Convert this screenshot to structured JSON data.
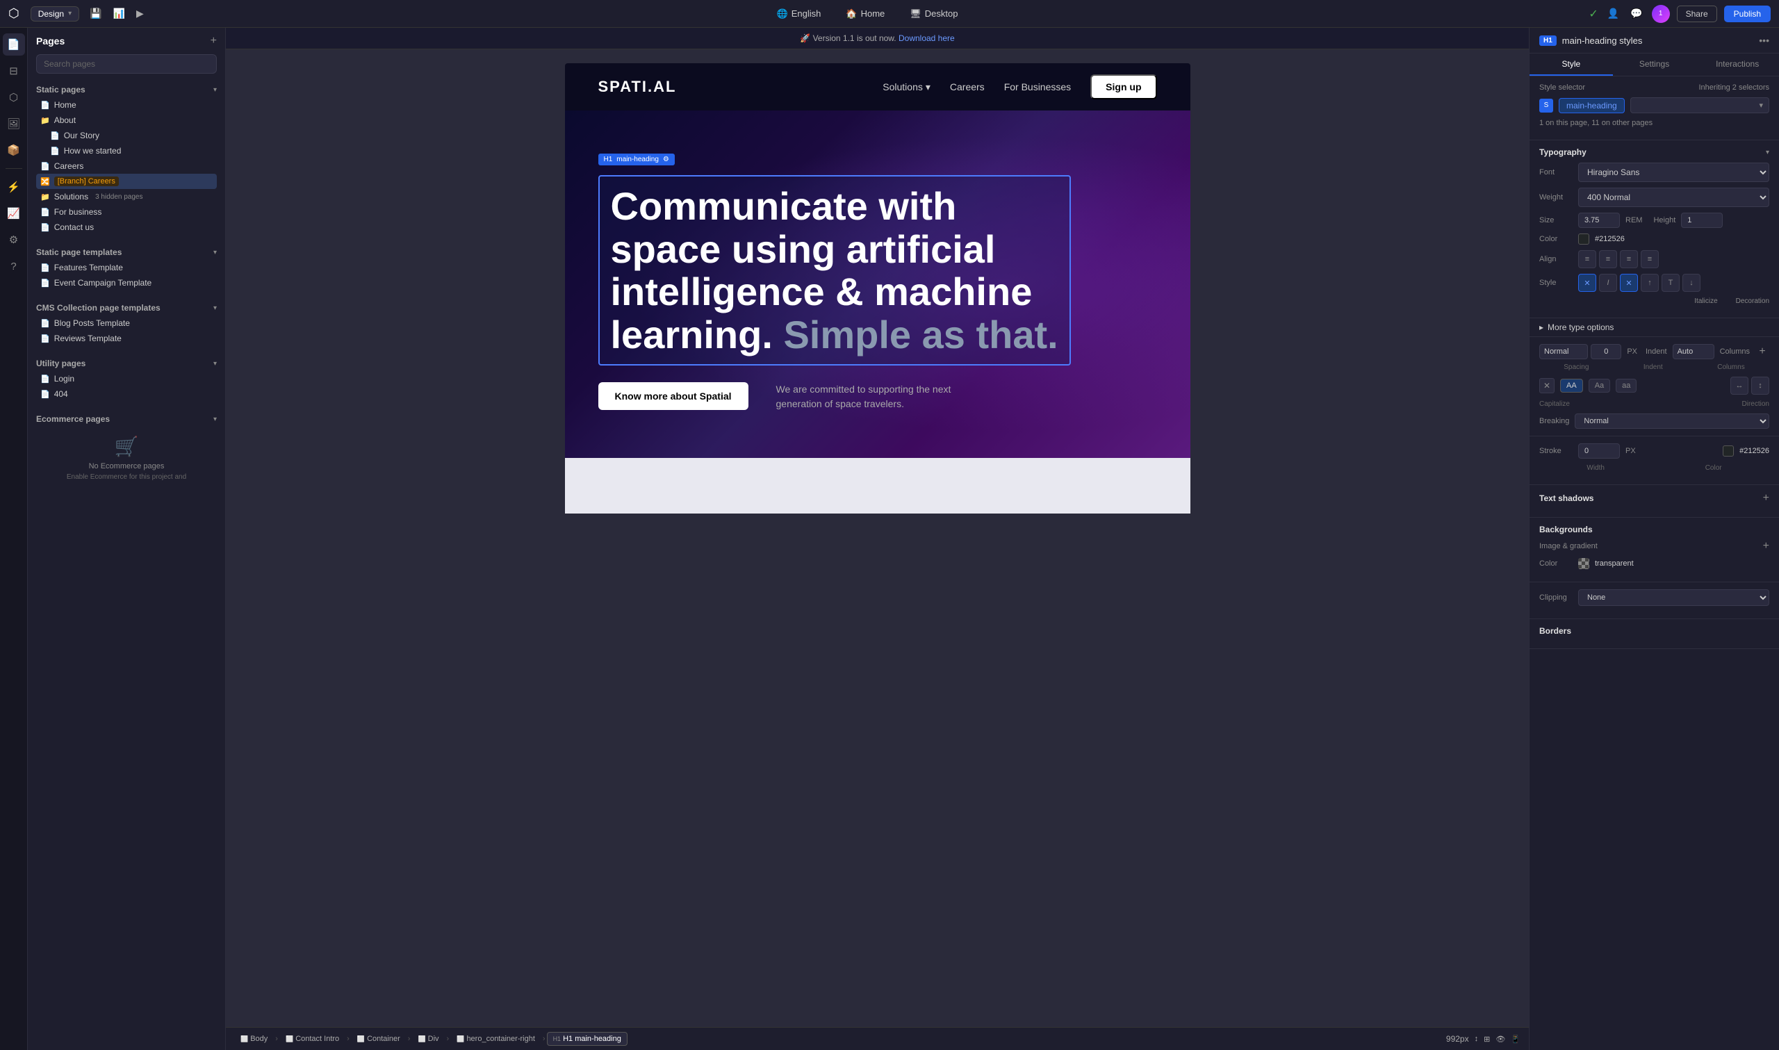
{
  "app": {
    "mode": "Design",
    "publish_label": "Publish",
    "share_label": "Share"
  },
  "topbar": {
    "mode": "Design",
    "icons": [
      "save-icon",
      "analytics-icon",
      "play-icon"
    ],
    "center_items": [
      {
        "label": "English",
        "icon": "globe-icon"
      },
      {
        "label": "Home",
        "icon": "home-icon"
      },
      {
        "label": "Desktop",
        "icon": "desktop-icon"
      }
    ],
    "version_banner": "Version 1.1 is out now.",
    "version_link": "Download here"
  },
  "sidebar": {
    "title": "Pages",
    "search_placeholder": "Search pages",
    "sections": [
      {
        "title": "Static pages",
        "pages": [
          {
            "label": "Home",
            "type": "page",
            "indent": 0
          },
          {
            "label": "About",
            "type": "folder",
            "indent": 0
          },
          {
            "label": "Our Story",
            "type": "page",
            "indent": 1
          },
          {
            "label": "How we started",
            "type": "page",
            "indent": 1
          },
          {
            "label": "Careers",
            "type": "page",
            "indent": 0
          },
          {
            "label": "[Branch] Careers",
            "type": "branch",
            "indent": 0
          },
          {
            "label": "Solutions",
            "type": "folder",
            "indent": 0,
            "badge": "3 hidden pages"
          },
          {
            "label": "For business",
            "type": "page",
            "indent": 0
          },
          {
            "label": "Contact us",
            "type": "page",
            "indent": 0
          }
        ]
      },
      {
        "title": "Static page templates",
        "pages": [
          {
            "label": "Features Template",
            "type": "page",
            "indent": 0
          },
          {
            "label": "Event Campaign Template",
            "type": "page",
            "indent": 0
          }
        ]
      },
      {
        "title": "CMS Collection page templates",
        "pages": [
          {
            "label": "Blog Posts Template",
            "type": "page",
            "indent": 0
          },
          {
            "label": "Reviews Template",
            "type": "page",
            "indent": 0
          }
        ]
      },
      {
        "title": "Utility pages",
        "pages": [
          {
            "label": "Login",
            "type": "page",
            "indent": 0
          },
          {
            "label": "404",
            "type": "page",
            "indent": 0
          }
        ]
      },
      {
        "title": "Ecommerce pages",
        "pages": [],
        "empty_label": "No Ecommerce pages",
        "empty_desc": "Enable Ecommerce for this project and"
      }
    ]
  },
  "canvas": {
    "banner_text": "Version 1.1 is out now.",
    "banner_link": "Download here",
    "site": {
      "logo": "SPATI.AL",
      "nav_links": [
        "Solutions",
        "Careers",
        "For Businesses"
      ],
      "signup_label": "Sign up",
      "hero_heading_line1": "Communicate with",
      "hero_heading_line2": "space using artificial",
      "hero_heading_line3": "intelligence & machine",
      "hero_heading_line4": "learning.",
      "hero_heading_gray": " Simple as that.",
      "cta_label": "Know more about Spatial",
      "desc_text": "We are committed to supporting the next generation of space travelers.",
      "element_tag": "H1",
      "element_class": "main-heading"
    }
  },
  "right_panel": {
    "element_tag": "H1",
    "element_name": "main-heading styles",
    "tabs": [
      "Style",
      "Settings",
      "Interactions"
    ],
    "active_tab": "Style",
    "style_selector_label": "Style selector",
    "style_selector_value": "Inheriting 2 selectors",
    "style_tag": "main-heading",
    "selector_info": "1 on this page, 11 on other pages",
    "typography": {
      "title": "Typography",
      "font_label": "Font",
      "font_value": "Hiragino Sans",
      "weight_label": "Weight",
      "weight_value": "400 Normal",
      "size_label": "Size",
      "size_value": "3.75",
      "size_unit": "REM",
      "height_label": "Height",
      "height_value": "1",
      "color_label": "Color",
      "color_value": "#212526",
      "align_label": "Align",
      "style_label": "Style",
      "style_options": [
        "X",
        "I",
        "X",
        "↑",
        "T",
        "↓"
      ],
      "italicize_label": "Italicize",
      "decoration_label": "Decoration",
      "more_type_label": "More type options",
      "spacing_label": "Spacing",
      "spacing_value": "Normal",
      "spacing_num": "0",
      "spacing_unit": "PX",
      "indent_label": "Indent",
      "indent_value": "Auto",
      "columns_label": "Columns",
      "transform_options": [
        "X",
        "AA",
        "Aa",
        "aa"
      ],
      "capitalize_label": "Capitalize",
      "direction_label": "Direction",
      "breaking_label": "Breaking",
      "breaking_value": "Normal"
    },
    "stroke": {
      "title": "Stroke",
      "value": "0",
      "unit": "PX",
      "width_label": "Width",
      "color_label": "Color",
      "color_value": "#212526"
    },
    "text_shadows": {
      "title": "Text shadows"
    },
    "backgrounds": {
      "title": "Backgrounds",
      "image_gradient_label": "Image & gradient",
      "color_label": "Color",
      "color_value": "transparent"
    },
    "borders_label": "Borders",
    "clipping_label": "Clipping",
    "clipping_value": "None"
  },
  "bottom_bar": {
    "breadcrumbs": [
      "Body",
      "Contact Intro",
      "Container",
      "Div",
      "hero_container-right",
      "H1 main-heading"
    ],
    "zoom": "992px"
  }
}
